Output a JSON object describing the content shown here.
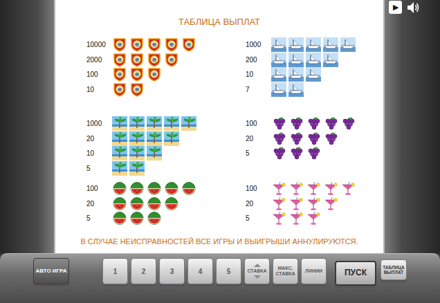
{
  "title": "ТАБЛИЦА ВЫПЛАТ",
  "top_controls": {
    "play": "▶"
  },
  "paytable": [
    {
      "kind": "shield",
      "glyph": "e",
      "rows": [
        {
          "payout": "10000",
          "count": 5
        },
        {
          "payout": "2000",
          "count": 4
        },
        {
          "payout": "100",
          "count": 3
        },
        {
          "payout": "10",
          "count": 2
        }
      ]
    },
    {
      "kind": "ship",
      "rows": [
        {
          "payout": "1000",
          "count": 5
        },
        {
          "payout": "200",
          "count": 4
        },
        {
          "payout": "10",
          "count": 3
        },
        {
          "payout": "7",
          "count": 2
        }
      ]
    },
    {
      "kind": "palm",
      "rows": [
        {
          "payout": "1000",
          "count": 5
        },
        {
          "payout": "20",
          "count": 4
        },
        {
          "payout": "10",
          "count": 3
        },
        {
          "payout": "5",
          "count": 2
        }
      ]
    },
    {
      "kind": "grapes",
      "rows": [
        {
          "payout": "100",
          "count": 5
        },
        {
          "payout": "20",
          "count": 4
        },
        {
          "payout": "5",
          "count": 3
        }
      ]
    },
    {
      "kind": "watermelon",
      "rows": [
        {
          "payout": "100",
          "count": 5
        },
        {
          "payout": "20",
          "count": 4
        },
        {
          "payout": "5",
          "count": 3
        }
      ]
    },
    {
      "kind": "cocktail",
      "rows": [
        {
          "payout": "100",
          "count": 5
        },
        {
          "payout": "20",
          "count": 4
        },
        {
          "payout": "5",
          "count": 3
        }
      ]
    }
  ],
  "notice": "В СЛУЧАЕ НЕИСПРАВНОСТЕЙ ВСЕ ИГРЫ И ВЫИГРЫШИ АННУЛИРУЮТСЯ.",
  "buttons": [
    {
      "label": "АВТО ИГРА",
      "kind": "auto"
    },
    {
      "label": "1",
      "kind": "number"
    },
    {
      "label": "2",
      "kind": "number"
    },
    {
      "label": "3",
      "kind": "number"
    },
    {
      "label": "4",
      "kind": "number"
    },
    {
      "label": "5",
      "kind": "number"
    },
    {
      "label": "СТАВКА",
      "kind": "bet"
    },
    {
      "label": "МАКС. СТАВКА",
      "kind": "max"
    },
    {
      "label": "ЛИНИИ",
      "kind": "lines"
    },
    {
      "label": "ПУСК",
      "kind": "spin"
    },
    {
      "label": "ТАБЛИЦА ВЫПЛАТ",
      "kind": "paytable"
    }
  ]
}
